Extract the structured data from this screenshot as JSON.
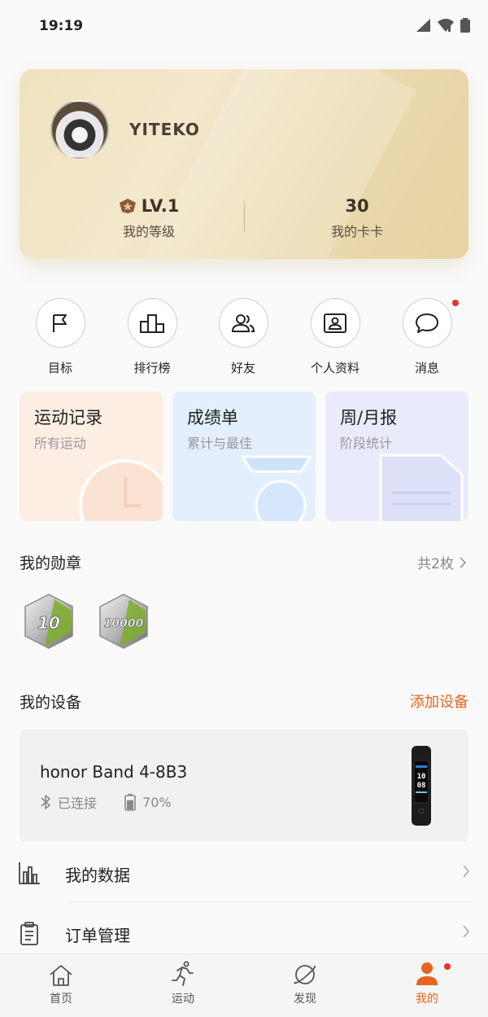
{
  "status_bar": {
    "time": "19:19"
  },
  "profile": {
    "username": "YITEKO",
    "level_value": "LV.1",
    "level_label": "我的等级",
    "kaka_value": "30",
    "kaka_label": "我的卡卡"
  },
  "quick_actions": [
    {
      "label": "目标",
      "icon": "flag-icon"
    },
    {
      "label": "排行榜",
      "icon": "leaderboard-icon"
    },
    {
      "label": "好友",
      "icon": "friends-icon"
    },
    {
      "label": "个人资料",
      "icon": "profile-card-icon"
    },
    {
      "label": "消息",
      "icon": "message-icon"
    }
  ],
  "feature_cards": [
    {
      "title": "运动记录",
      "subtitle": "所有运动"
    },
    {
      "title": "成绩单",
      "subtitle": "累计与最佳"
    },
    {
      "title": "周/月报",
      "subtitle": "阶段统计"
    }
  ],
  "medals": {
    "title": "我的勋章",
    "count_label": "共2枚",
    "items": [
      "10",
      "10000"
    ]
  },
  "devices": {
    "title": "我的设备",
    "add_label": "添加设备",
    "device_name": "honor Band 4-8B3",
    "connection": "已连接",
    "battery": "70%",
    "battery_level": 0.7,
    "band_time_hour": "10",
    "band_time_min": "08"
  },
  "menu": [
    {
      "label": "我的数据",
      "icon": "bar-chart-icon"
    },
    {
      "label": "订单管理",
      "icon": "clipboard-icon"
    }
  ],
  "tabs": [
    {
      "label": "首页",
      "icon": "home-icon"
    },
    {
      "label": "运动",
      "icon": "running-icon"
    },
    {
      "label": "发现",
      "icon": "planet-icon"
    },
    {
      "label": "我的",
      "icon": "person-icon"
    }
  ],
  "colors": {
    "accent": "#e6651e",
    "notification": "#e8342c",
    "card_gold": "#efe2bf"
  }
}
